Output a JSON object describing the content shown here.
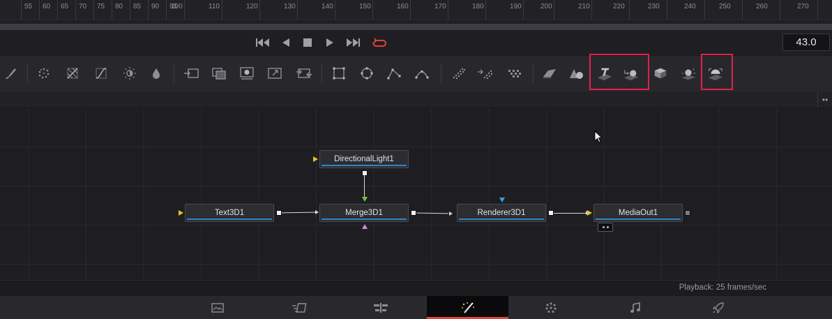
{
  "ruler": {
    "labels": [
      "55",
      "60",
      "65",
      "70",
      "75",
      "80",
      "85",
      "90",
      "95",
      "100",
      "110",
      "120",
      "130",
      "140",
      "150",
      "160",
      "170",
      "180",
      "190",
      "200",
      "210",
      "220",
      "230",
      "240",
      "250",
      "260",
      "270"
    ]
  },
  "transport": {
    "buttons": [
      {
        "name": "go-to-start-button",
        "icon": "skip-back-icon"
      },
      {
        "name": "play-reverse-button",
        "icon": "play-reverse-icon"
      },
      {
        "name": "stop-button",
        "icon": "stop-icon"
      },
      {
        "name": "play-forward-button",
        "icon": "play-icon"
      },
      {
        "name": "go-to-end-button",
        "icon": "skip-forward-icon"
      },
      {
        "name": "loop-button",
        "icon": "loop-icon",
        "color": "#e0413c"
      }
    ],
    "current_frame": "43.0"
  },
  "toolbar": {
    "tools": [
      "paint-brush-icon",
      "particles-icon",
      "color-corrector-icon",
      "color-curves-icon",
      "brightness-contrast-icon",
      "blur-icon",
      "background-icon",
      "merge-icon",
      "transform-icon",
      "resize-icon",
      "loader-icon",
      "rectangle-mask-icon",
      "ellipse-mask-icon",
      "polygon-mask-icon",
      "bspline-mask-icon",
      "particle-emitter-icon",
      "particle-render-icon",
      "particle-grid-icon",
      "image-plane-3d-icon",
      "shape-3d-icon",
      "text-3d-icon",
      "merge-3d-icon",
      "camera-3d-icon",
      "spotlight-3d-icon",
      "renderer-3d-icon"
    ],
    "highlight_color": "#e2204a"
  },
  "nodes": {
    "directional_light": "DirectionalLight1",
    "text3d": "Text3D1",
    "merge3d": "Merge3D1",
    "renderer3d": "Renderer3D1",
    "mediaout": "MediaOut1"
  },
  "status": {
    "playback": "Playback: 25 frames/sec"
  },
  "pages": {
    "items": [
      {
        "name": "media-page",
        "icon": "media-icon"
      },
      {
        "name": "cut-page",
        "icon": "cut-icon"
      },
      {
        "name": "edit-page",
        "icon": "edit-icon"
      },
      {
        "name": "fusion-page",
        "icon": "fusion-wand-icon",
        "active": true
      },
      {
        "name": "color-page",
        "icon": "color-icon"
      },
      {
        "name": "fairlight-page",
        "icon": "music-note-icon"
      },
      {
        "name": "deliver-page",
        "icon": "rocket-icon"
      }
    ],
    "active_color": "#e0413c"
  }
}
